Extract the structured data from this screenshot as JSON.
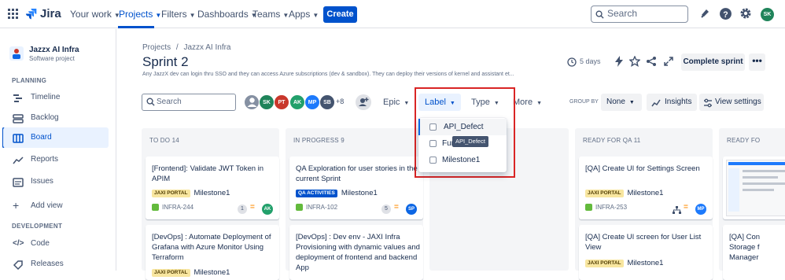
{
  "topnav": {
    "logo": "Jira",
    "items": [
      {
        "label": "Your work"
      },
      {
        "label": "Projects"
      },
      {
        "label": "Filters"
      },
      {
        "label": "Dashboards"
      },
      {
        "label": "Teams"
      },
      {
        "label": "Apps"
      }
    ],
    "create_label": "Create",
    "search_placeholder": "Search",
    "user_initials": "SK"
  },
  "sidebar": {
    "project_name": "Jazzx AI Infra",
    "project_type": "Software project",
    "planning_title": "PLANNING",
    "planning_items": [
      {
        "label": "Timeline",
        "icon": "timeline-icon"
      },
      {
        "label": "Backlog",
        "icon": "backlog-icon"
      },
      {
        "label": "Board",
        "icon": "board-icon",
        "active": true
      },
      {
        "label": "Reports",
        "icon": "reports-icon"
      },
      {
        "label": "Issues",
        "icon": "issues-icon"
      },
      {
        "label": "Add view",
        "icon": "plus-icon"
      }
    ],
    "development_title": "DEVELOPMENT",
    "development_items": [
      {
        "label": "Code",
        "icon": "code-icon"
      },
      {
        "label": "Releases",
        "icon": "releases-icon"
      }
    ]
  },
  "header": {
    "breadcrumb_projects": "Projects",
    "breadcrumb_sep": "/",
    "breadcrumb_project": "Jazzx AI Infra",
    "title": "Sprint 2",
    "description": "Any JazzX dev can login thru SSO and they can access Azure subscriptions (dev & sandbox). They can deploy their versions of kernel and assistant et...",
    "days_left": "5 days",
    "complete_label": "Complete sprint",
    "more_label": "•••"
  },
  "toolbar": {
    "search_placeholder": "Search",
    "avatars": [
      {
        "initials": "",
        "color": "#8590a2"
      },
      {
        "initials": "SK",
        "color": "#1f845a"
      },
      {
        "initials": "PT",
        "color": "#c9372c"
      },
      {
        "initials": "AK",
        "color": "#22a06b"
      },
      {
        "initials": "MP",
        "color": "#1d7afc"
      },
      {
        "initials": "SB",
        "color": "#44546f"
      }
    ],
    "more_count": "+8",
    "epic_label": "Epic",
    "label_label": "Label",
    "type_label": "Type",
    "more_label": "More",
    "groupby_label": "GROUP BY",
    "groupby_value": "None",
    "insights_label": "Insights",
    "view_settings_label": "View settings"
  },
  "label_dropdown": {
    "options": [
      "API_Defect",
      "Fun",
      "Milestone1"
    ],
    "tooltip": "API_Defect"
  },
  "columns": [
    {
      "title": "TO DO 14",
      "cards": [
        {
          "title": "[Frontend]: Validate JWT Token in APIM",
          "tag": "JAXI PORTAL",
          "tag_style": "jaxi",
          "milestone": "Milestone1",
          "key": "INFRA-244",
          "estimate": "1",
          "assignee": "AK",
          "assignee_color": "#22a06b"
        },
        {
          "title": "[DevOps] : Automate Deployment of Grafana with Azure Monitor Using Terraform",
          "tag": "JAXI PORTAL",
          "tag_style": "jaxi",
          "milestone": "Milestone1"
        }
      ]
    },
    {
      "title": "IN PROGRESS 9",
      "cards": [
        {
          "title": "QA Exploration for user stories in the current Sprint",
          "tag": "QA ACTIVITIES",
          "tag_style": "qa",
          "milestone": "Milestone1",
          "key": "INFRA-102",
          "estimate": "5",
          "assignee": "SP",
          "assignee_color": "#0c66e4"
        },
        {
          "title": "[DevOps] : Dev env - JAXI Infra Provisioning with dynamic values and deployment of frontend and backend App"
        }
      ]
    },
    {
      "title": "",
      "cards": []
    },
    {
      "title": "READY FOR QA 11",
      "cards": [
        {
          "title": "[QA] Create UI for Settings Screen",
          "tag": "JAXI PORTAL",
          "tag_style": "jaxi",
          "milestone": "Milestone1",
          "key": "INFRA-253",
          "assignee": "MP",
          "assignee_color": "#1d7afc"
        },
        {
          "title": "[QA] Create UI screen for User List View",
          "tag": "JAXI PORTAL",
          "tag_style": "jaxi",
          "milestone": "Milestone1"
        }
      ]
    },
    {
      "title": "READY FO",
      "cards": [
        {
          "title": ""
        },
        {
          "title": "[QA] Con Storage f Manager"
        }
      ]
    }
  ]
}
